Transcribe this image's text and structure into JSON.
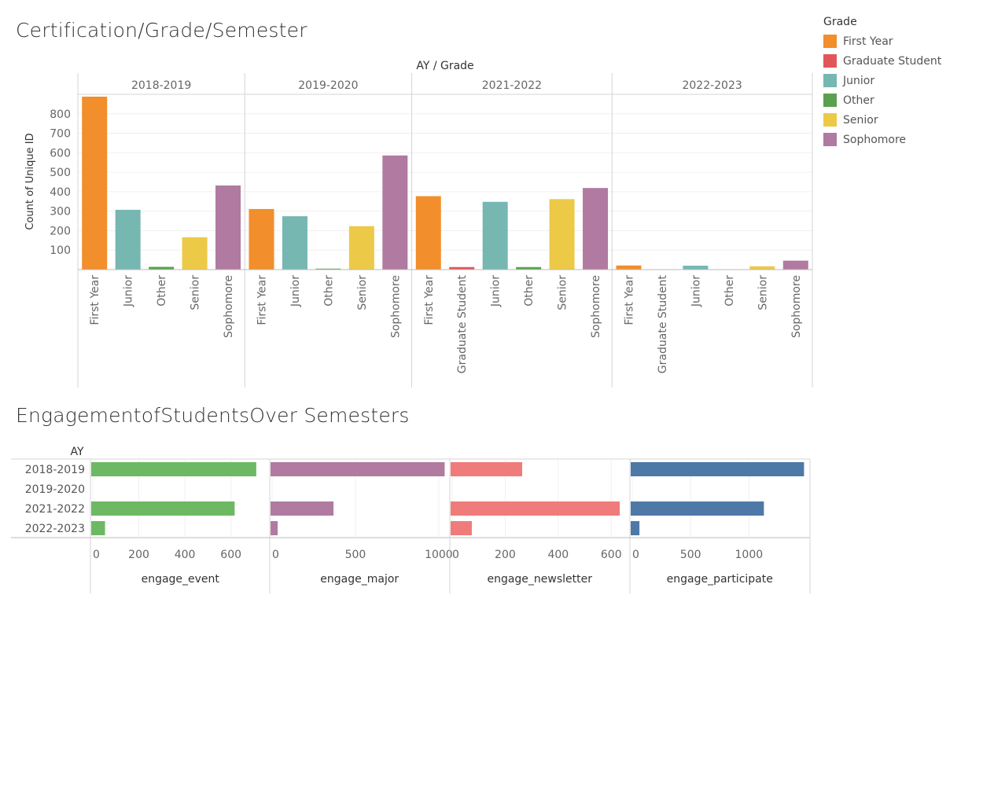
{
  "colors": {
    "First Year": "#f28e2b",
    "Graduate Student": "#e15759",
    "Junior": "#76b7b2",
    "Other": "#59a14f",
    "Senior": "#edc948",
    "Sophomore": "#b07aa1"
  },
  "legend": {
    "title": "Grade",
    "items": [
      {
        "label": "First Year",
        "color": "#f28e2b"
      },
      {
        "label": "Graduate Student",
        "color": "#e15759"
      },
      {
        "label": "Junior",
        "color": "#76b7b2"
      },
      {
        "label": "Other",
        "color": "#59a14f"
      },
      {
        "label": "Senior",
        "color": "#edc948"
      },
      {
        "label": "Sophomore",
        "color": "#b07aa1"
      }
    ]
  },
  "chart_data": [
    {
      "type": "bar",
      "title": "Certification/Grade/Semester",
      "column_header": "AY / Grade",
      "ylabel": "Count of Unique ID",
      "ylim": [
        0,
        900
      ],
      "yticks": [
        100,
        200,
        300,
        400,
        500,
        600,
        700,
        800
      ],
      "grid": true,
      "legend_position": "right",
      "panels": [
        {
          "name": "2018-2019",
          "categories": [
            "First Year",
            "Junior",
            "Other",
            "Senior",
            "Sophomore"
          ],
          "values": [
            888,
            307,
            14,
            166,
            432
          ]
        },
        {
          "name": "2019-2020",
          "categories": [
            "First Year",
            "Junior",
            "Other",
            "Senior",
            "Sophomore"
          ],
          "values": [
            311,
            274,
            5,
            223,
            586
          ]
        },
        {
          "name": "2021-2022",
          "categories": [
            "First Year",
            "Graduate Student",
            "Junior",
            "Other",
            "Senior",
            "Sophomore"
          ],
          "values": [
            377,
            13,
            348,
            13,
            362,
            419
          ]
        },
        {
          "name": "2022-2023",
          "categories": [
            "First Year",
            "Graduate Student",
            "Junior",
            "Other",
            "Senior",
            "Sophomore"
          ],
          "values": [
            21,
            1,
            20,
            1,
            17,
            46
          ]
        }
      ]
    },
    {
      "type": "bar",
      "orientation": "horizontal",
      "title": "EngagementofStudentsOver Semesters",
      "row_header": "AY",
      "categories": [
        "2018-2019",
        "2019-2020",
        "2021-2022",
        "2022-2023"
      ],
      "grid": true,
      "series": [
        {
          "name": "engage_event",
          "color": "#6db963",
          "xlim": [
            0,
            760
          ],
          "ticks": [
            0,
            200,
            400,
            600
          ],
          "values": [
            717,
            0,
            623,
            60
          ]
        },
        {
          "name": "engage_major",
          "color": "#b07aa1",
          "xlim": [
            0,
            1050
          ],
          "ticks": [
            0,
            500,
            1000
          ],
          "values": [
            1045,
            0,
            378,
            43
          ]
        },
        {
          "name": "engage_newsletter",
          "color": "#f07b7b",
          "xlim": [
            0,
            660
          ],
          "ticks": [
            0,
            200,
            400,
            600
          ],
          "values": [
            270,
            0,
            638,
            80
          ]
        },
        {
          "name": "engage_participate",
          "color": "#4e79a7",
          "xlim": [
            0,
            1500
          ],
          "ticks": [
            0,
            500,
            1000
          ],
          "values": [
            1486,
            0,
            1142,
            75
          ]
        }
      ]
    }
  ]
}
